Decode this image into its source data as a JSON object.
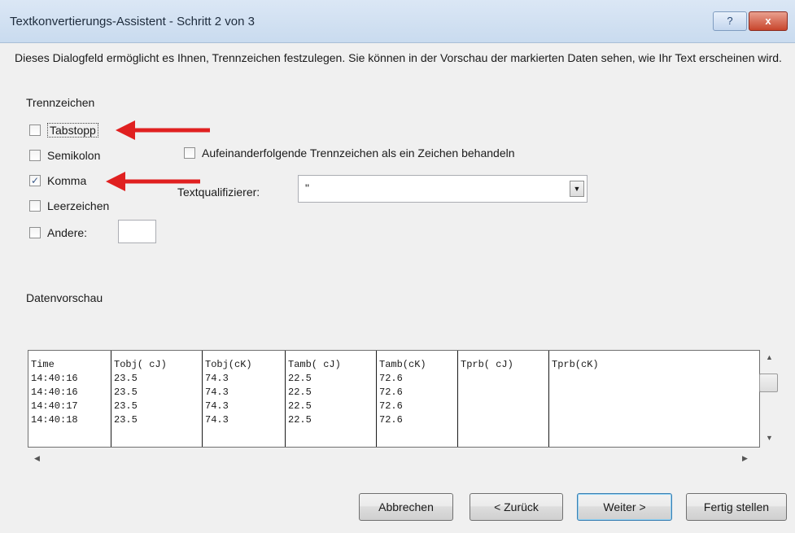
{
  "window": {
    "title": "Textkonvertierungs-Assistent - Schritt 2 von 3",
    "help_glyph": "?",
    "close_glyph": "x"
  },
  "description": "Dieses Dialogfeld ermöglicht es Ihnen, Trennzeichen festzulegen. Sie können in der Vorschau der markierten Daten sehen, wie Ihr Text erscheinen wird.",
  "delimiters": {
    "group_label": "Trennzeichen",
    "options": [
      {
        "label": "Tabstopp",
        "checked": false
      },
      {
        "label": "Semikolon",
        "checked": false
      },
      {
        "label": "Komma",
        "checked": true
      },
      {
        "label": "Leerzeichen",
        "checked": false
      },
      {
        "label": "Andere:",
        "checked": false
      }
    ],
    "other_value": "",
    "consecutive_label": "Aufeinanderfolgende Trennzeichen als ein Zeichen behandeln",
    "consecutive_checked": false
  },
  "text_qualifier": {
    "label": "Textqualifizierer:",
    "value": "\""
  },
  "preview": {
    "label": "Datenvorschau",
    "columns": [
      {
        "header": "Time",
        "cells": [
          "14:40:16",
          "14:40:16",
          "14:40:17",
          "14:40:18"
        ]
      },
      {
        "header": "Tobj( cJ)",
        "cells": [
          "23.5",
          "23.5",
          "23.5",
          "23.5"
        ]
      },
      {
        "header": "Tobj(cK)",
        "cells": [
          "74.3",
          "74.3",
          "74.3",
          "74.3"
        ]
      },
      {
        "header": "Tamb( cJ)",
        "cells": [
          "22.5",
          "22.5",
          "22.5",
          "22.5"
        ]
      },
      {
        "header": "Tamb(cK)",
        "cells": [
          "72.6",
          "72.6",
          "72.6",
          "72.6"
        ]
      },
      {
        "header": "Tprb( cJ)",
        "cells": [
          "",
          "",
          "",
          ""
        ]
      },
      {
        "header": "Tprb(cK)",
        "cells": [
          "",
          "",
          "",
          ""
        ]
      }
    ]
  },
  "buttons": {
    "cancel": "Abbrechen",
    "back": "< Zurück",
    "next": "Weiter >",
    "finish": "Fertig stellen"
  },
  "annotation_color": "#e02020",
  "checkmark": "✓"
}
